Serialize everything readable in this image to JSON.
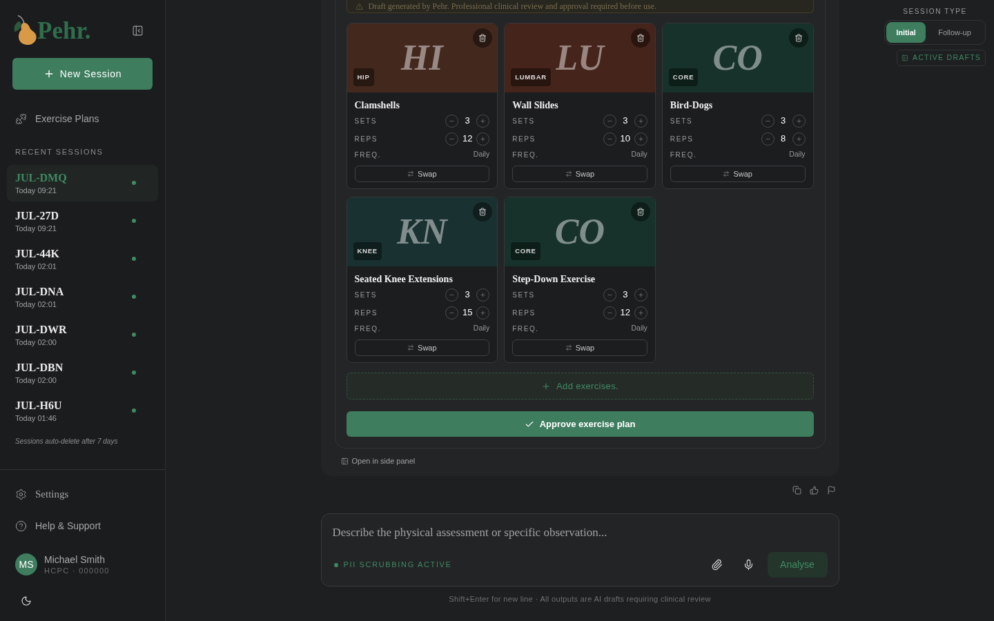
{
  "sidebar": {
    "logo": "Pehr.",
    "new_session_button": "New Session",
    "nav": [
      {
        "label": "Exercise Plans"
      }
    ],
    "recent_heading": "RECENT SESSIONS",
    "sessions": [
      {
        "code": "JUL-DMQ",
        "time": "Today 09:21",
        "selected": true
      },
      {
        "code": "JUL-27D",
        "time": "Today 09:21",
        "selected": false
      },
      {
        "code": "JUL-44K",
        "time": "Today 02:01",
        "selected": false
      },
      {
        "code": "JUL-DNA",
        "time": "Today 02:01",
        "selected": false
      },
      {
        "code": "JUL-DWR",
        "time": "Today 02:00",
        "selected": false
      },
      {
        "code": "JUL-DBN",
        "time": "Today 02:00",
        "selected": false
      },
      {
        "code": "JUL-H6U",
        "time": "Today 01:46",
        "selected": false
      }
    ],
    "retention_note": "Sessions auto-delete after 7 days",
    "footer_nav": [
      {
        "kind": "settings",
        "label": "Settings"
      },
      {
        "kind": "help",
        "label": "Help & Support"
      }
    ],
    "user": {
      "initials": "MS",
      "name": "Michael Smith",
      "registration": "HCPC · 000000"
    }
  },
  "session_type": {
    "label": "SESSION TYPE",
    "options": [
      {
        "label": "Initial",
        "selected": true
      },
      {
        "label": "Follow-up",
        "selected": false
      }
    ],
    "active_drafts_button": "ACTIVE DRAFTS"
  },
  "draft": {
    "banner": "Draft generated by Pehr. Professional clinical review and approval required before use.",
    "exercises": [
      {
        "name": "Clamshells",
        "region": "HIP",
        "monogram": "HI",
        "color": "#43281e",
        "fields": [
          {
            "kind": "stepper",
            "label": "SETS",
            "value": "3"
          },
          {
            "kind": "stepper",
            "label": "REPS",
            "value": "12"
          },
          {
            "kind": "text",
            "label": "FREQ.",
            "value": "Daily"
          }
        ],
        "swap_button": "Swap"
      },
      {
        "name": "Wall Slides",
        "region": "LUMBAR",
        "monogram": "LU",
        "color": "#45241b",
        "fields": [
          {
            "kind": "stepper",
            "label": "SETS",
            "value": "3"
          },
          {
            "kind": "stepper",
            "label": "REPS",
            "value": "10"
          },
          {
            "kind": "text",
            "label": "FREQ.",
            "value": "Daily"
          }
        ],
        "swap_button": "Swap"
      },
      {
        "name": "Bird-Dogs",
        "region": "CORE",
        "monogram": "CO",
        "color": "#17322a",
        "fields": [
          {
            "kind": "stepper",
            "label": "SETS",
            "value": "3"
          },
          {
            "kind": "stepper",
            "label": "REPS",
            "value": "8"
          },
          {
            "kind": "text",
            "label": "FREQ.",
            "value": "Daily"
          }
        ],
        "swap_button": "Swap"
      },
      {
        "name": "Seated Knee Extensions",
        "region": "KNEE",
        "monogram": "KN",
        "color": "#1a3131",
        "fields": [
          {
            "kind": "stepper",
            "label": "SETS",
            "value": "3"
          },
          {
            "kind": "stepper",
            "label": "REPS",
            "value": "15"
          },
          {
            "kind": "text",
            "label": "FREQ.",
            "value": "Daily"
          }
        ],
        "swap_button": "Swap"
      },
      {
        "name": "Step-Down Exercise",
        "region": "CORE",
        "monogram": "CO",
        "color": "#17322a",
        "fields": [
          {
            "kind": "stepper",
            "label": "SETS",
            "value": "3"
          },
          {
            "kind": "stepper",
            "label": "REPS",
            "value": "12"
          },
          {
            "kind": "text",
            "label": "FREQ.",
            "value": "Daily"
          }
        ],
        "swap_button": "Swap"
      }
    ],
    "add_button": "Add exercises.",
    "approve_button": "Approve exercise plan",
    "side_panel_link": "Open in side panel"
  },
  "composer": {
    "placeholder": "Describe the physical assessment or specific observation...",
    "pii_status": "PII SCRUBBING ACTIVE",
    "analyse_button": {
      "label": "Analyse",
      "disabled": true
    },
    "hint": "Shift+Enter for new line · All outputs are AI drafts requiring clinical review"
  }
}
